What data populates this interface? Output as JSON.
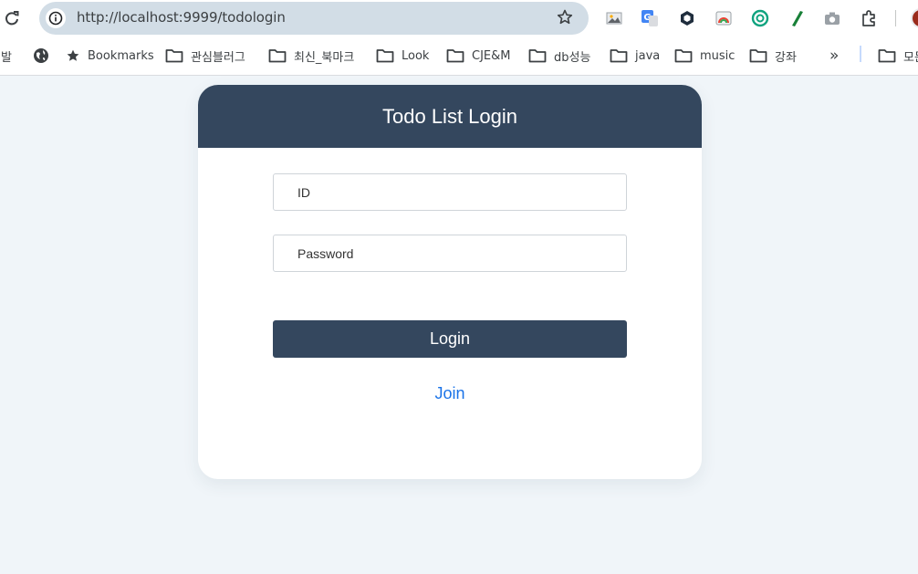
{
  "browser": {
    "url": "http://localhost:9999/todologin",
    "bookmarks": [
      {
        "label": "개발",
        "icon": "folder-icon"
      },
      {
        "label": "",
        "icon": "globe-icon"
      },
      {
        "label": "Bookmarks",
        "icon": "star-icon"
      },
      {
        "label": "관심블러그",
        "icon": "folder-icon"
      },
      {
        "label": "최신_북마크",
        "icon": "folder-icon"
      },
      {
        "label": "Look",
        "icon": "folder-icon"
      },
      {
        "label": "CJE&M",
        "icon": "folder-icon"
      },
      {
        "label": "db성능",
        "icon": "folder-icon"
      },
      {
        "label": "java",
        "icon": "folder-icon"
      },
      {
        "label": "music",
        "icon": "folder-icon"
      },
      {
        "label": "강좌",
        "icon": "folder-icon"
      },
      {
        "label": "»",
        "icon": "chevron-double-right-icon"
      },
      {
        "label": "모든",
        "icon": "folder-icon"
      }
    ],
    "extensions": [
      "image-extension-icon",
      "translate-extension-icon",
      "hexagon-extension-icon",
      "rainbow-extension-icon",
      "openai-extension-icon",
      "pen-extension-icon",
      "camera-extension-icon",
      "puzzle-extensions-icon"
    ]
  },
  "login": {
    "title": "Todo List Login",
    "id_placeholder": "ID",
    "password_placeholder": "Password",
    "login_label": "Login",
    "join_label": "Join"
  },
  "colors": {
    "header": "#34475e",
    "page_bg": "#f0f5f9",
    "link": "#1a73e8"
  }
}
